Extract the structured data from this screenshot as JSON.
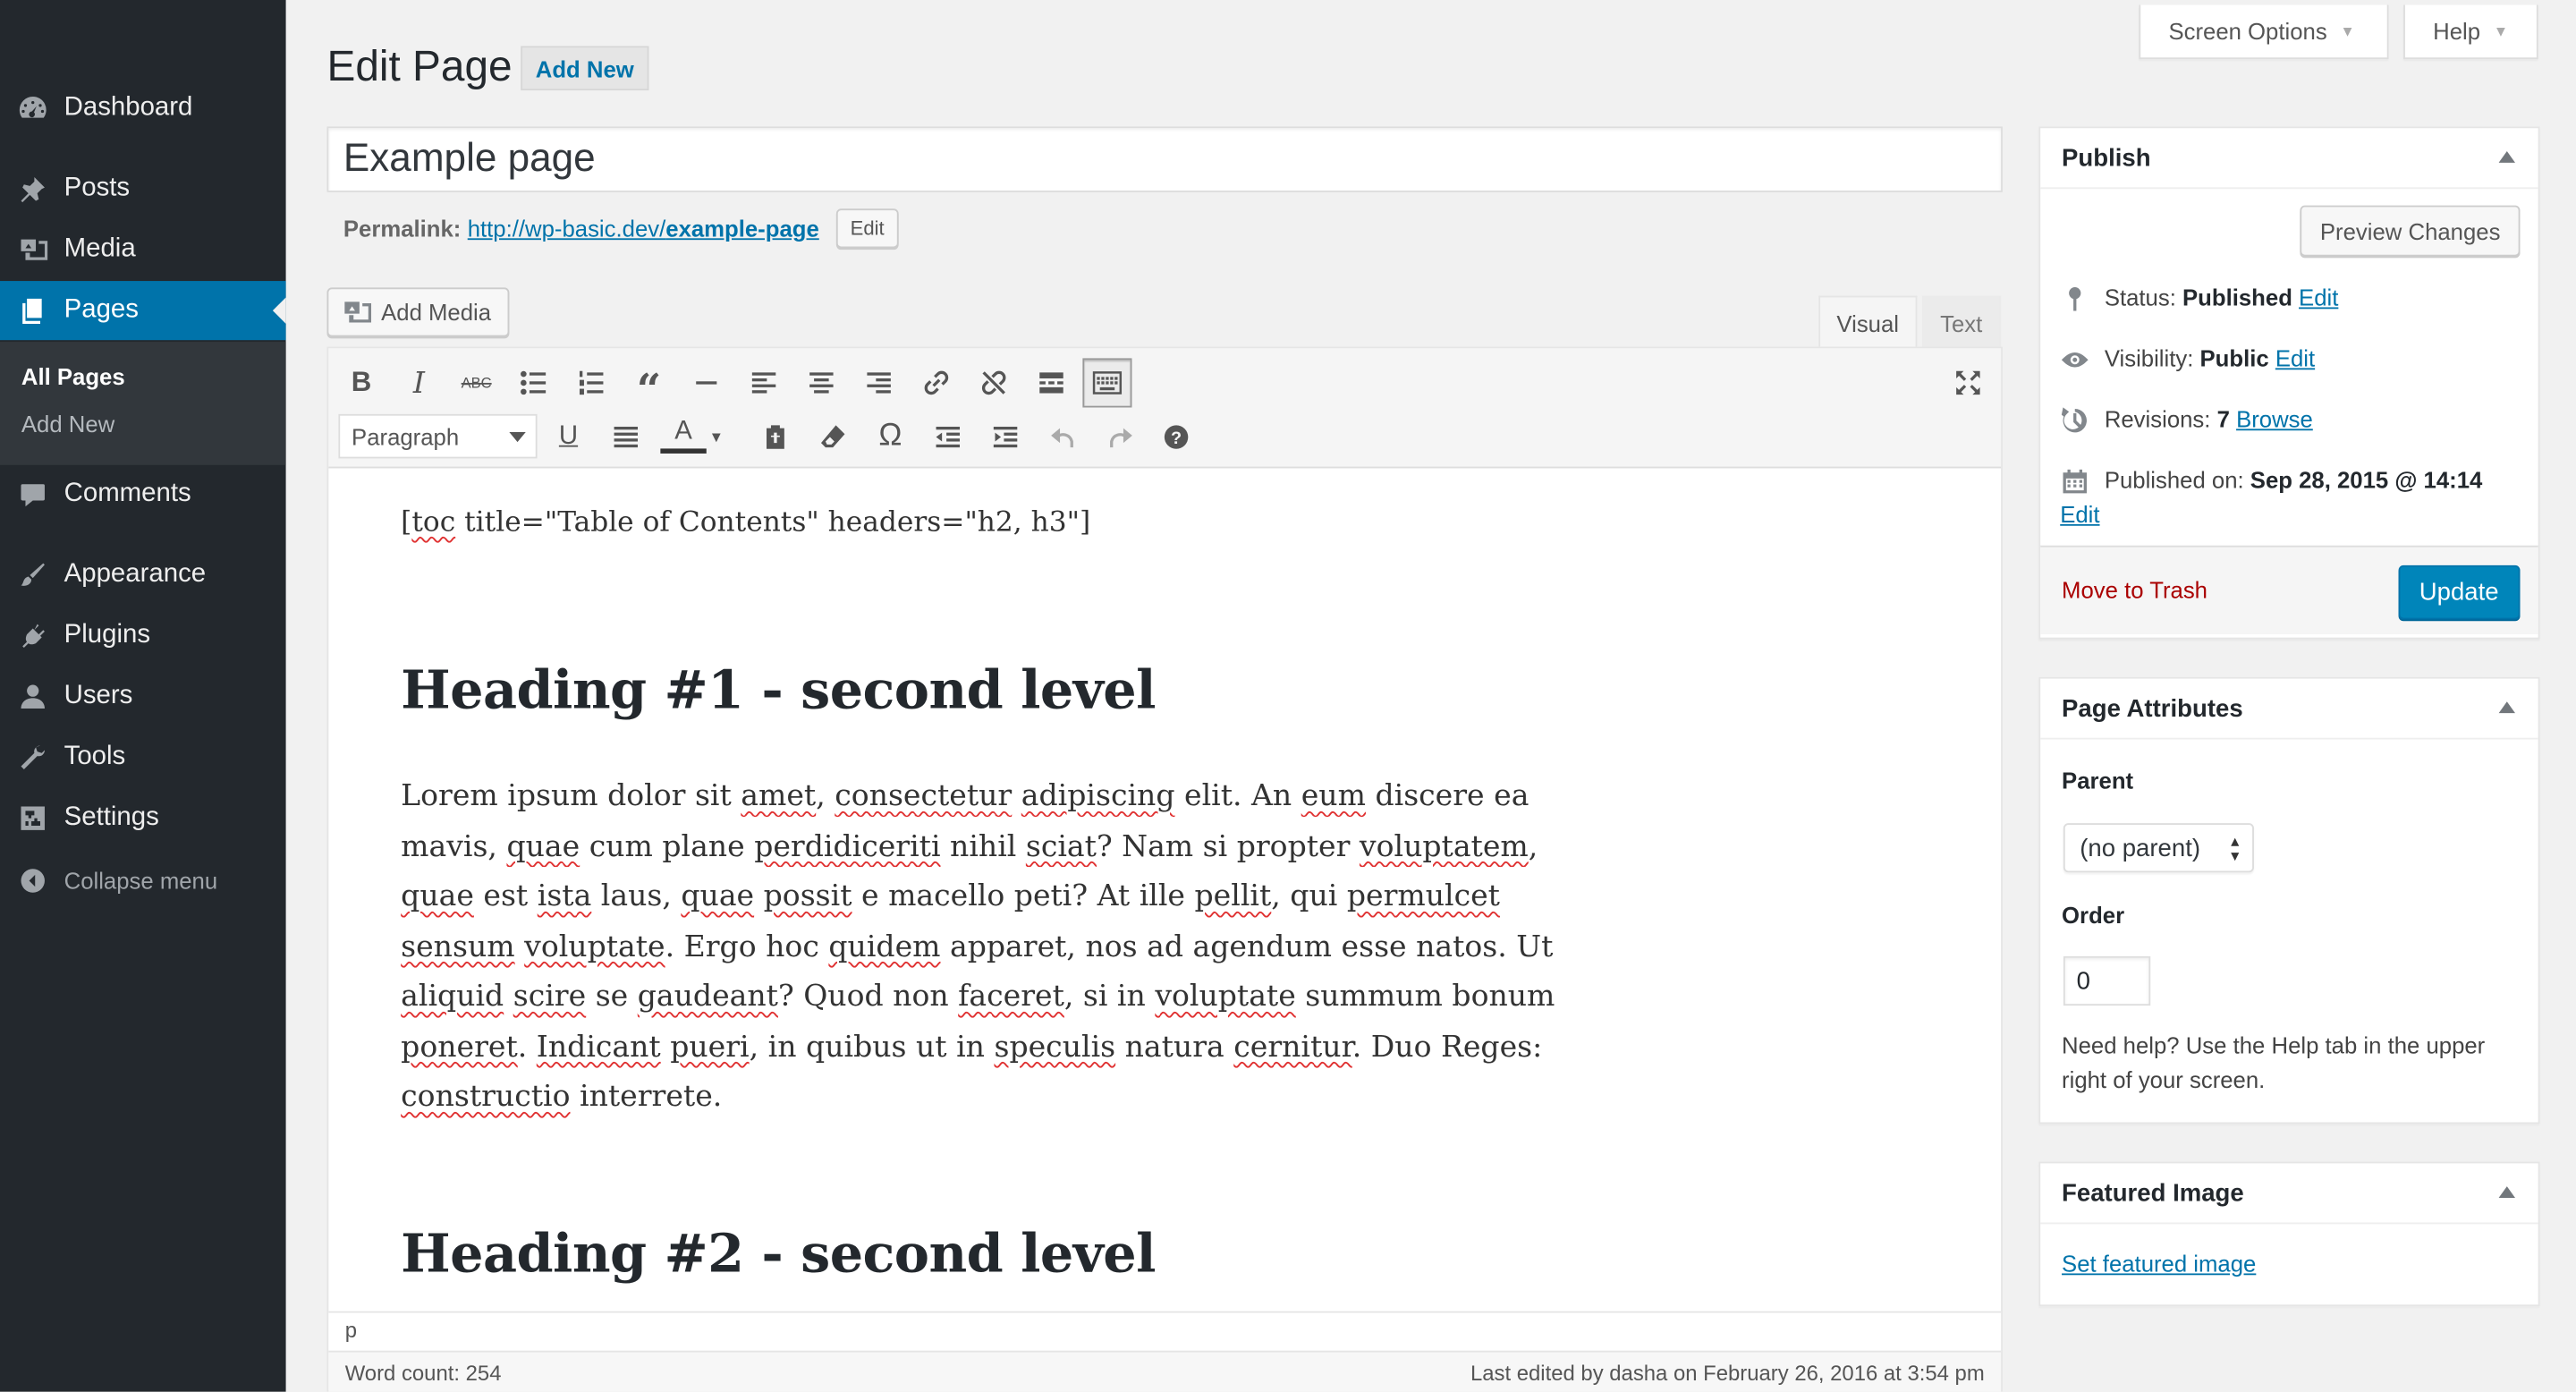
{
  "sidebar": {
    "items": [
      {
        "label": "Dashboard",
        "icon": "dashboard-icon"
      },
      {
        "label": "Posts",
        "icon": "pushpin-icon"
      },
      {
        "label": "Media",
        "icon": "media-icon"
      },
      {
        "label": "Pages",
        "icon": "pages-icon"
      },
      {
        "label": "Comments",
        "icon": "comments-icon"
      },
      {
        "label": "Appearance",
        "icon": "paintbrush-icon"
      },
      {
        "label": "Plugins",
        "icon": "plugin-icon"
      },
      {
        "label": "Users",
        "icon": "users-icon"
      },
      {
        "label": "Tools",
        "icon": "wrench-icon"
      },
      {
        "label": "Settings",
        "icon": "settings-icon"
      }
    ],
    "submenu": [
      "All Pages",
      "Add New"
    ],
    "collapse": "Collapse menu"
  },
  "header": {
    "title": "Edit Page",
    "add_new": "Add New",
    "screen_options": "Screen Options",
    "help": "Help"
  },
  "post": {
    "title": "Example page",
    "permalink_label": "Permalink:",
    "permalink_base": "http://wp-basic.dev/",
    "permalink_slug": "example-page",
    "permalink_edit": "Edit"
  },
  "editor": {
    "add_media": "Add Media",
    "tab_visual": "Visual",
    "tab_text": "Text",
    "format": "Paragraph",
    "shortcode": "[toc title=\"Table of Contents\" headers=\"h2, h3\"]",
    "heading1": "Heading #1 - second level",
    "heading2": "Heading #2 - second level",
    "path": "p",
    "word_count": "Word count: 254",
    "last_edited": "Last edited by dasha on February 26, 2016 at 3:54 pm"
  },
  "publish": {
    "title": "Publish",
    "preview": "Preview Changes",
    "status_label": "Status:",
    "status_value": "Published",
    "visibility_label": "Visibility:",
    "visibility_value": "Public",
    "revisions_label": "Revisions:",
    "revisions_value": "7",
    "browse": "Browse",
    "published_label": "Published on:",
    "published_value": "Sep 28, 2015 @ 14:14",
    "edit": "Edit",
    "trash": "Move to Trash",
    "update": "Update"
  },
  "attributes": {
    "title": "Page Attributes",
    "parent_label": "Parent",
    "parent_value": "(no parent)",
    "order_label": "Order",
    "order_value": "0",
    "help": "Need help? Use the Help tab in the upper right of your screen."
  },
  "featured": {
    "title": "Featured Image",
    "set": "Set featured image"
  },
  "colors": {
    "sidebar": "#23282d",
    "accent": "#0073aa",
    "update_button": "#0085ba",
    "trash": "#a00"
  }
}
